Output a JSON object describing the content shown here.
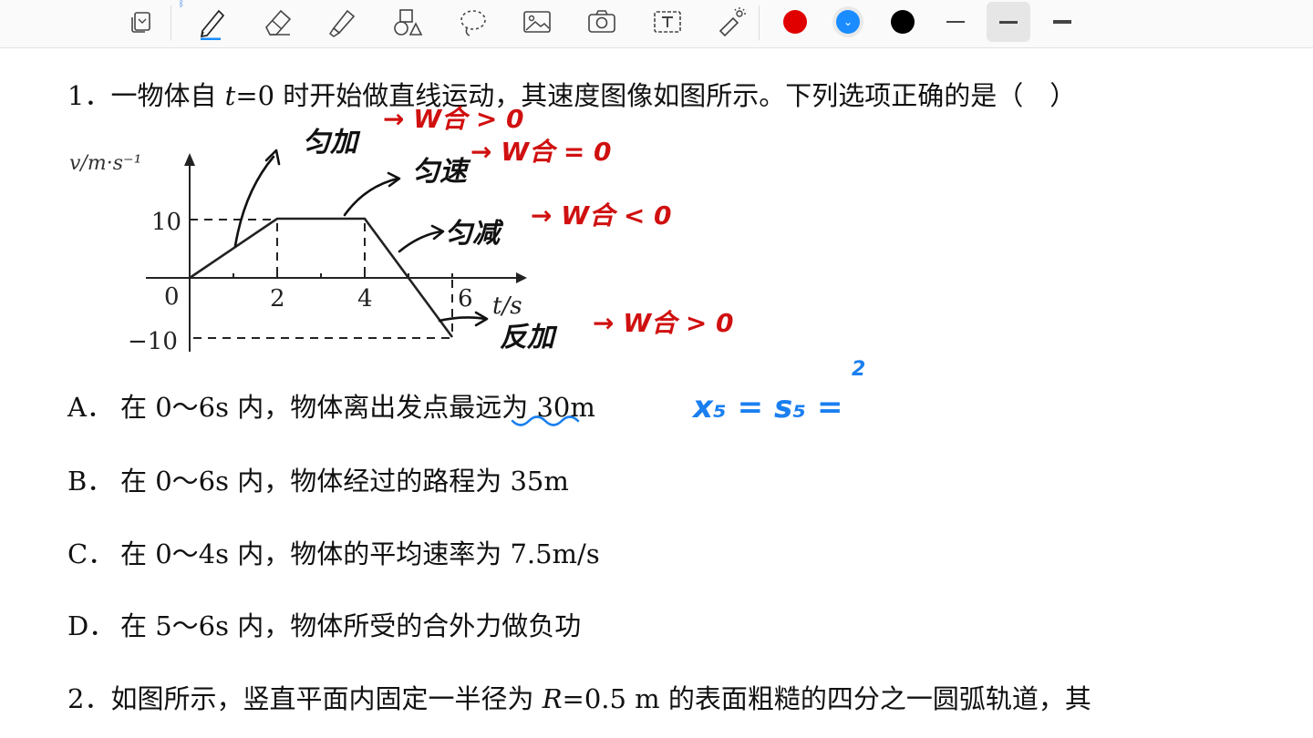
{
  "toolbar": {
    "tools": [
      {
        "name": "page-icon"
      },
      {
        "name": "pen-icon",
        "active": true
      },
      {
        "name": "eraser-icon"
      },
      {
        "name": "highlighter-icon"
      },
      {
        "name": "shapes-icon"
      },
      {
        "name": "lasso-icon"
      },
      {
        "name": "image-icon"
      },
      {
        "name": "camera-icon"
      },
      {
        "name": "text-box-icon"
      },
      {
        "name": "laser-pointer-icon"
      }
    ],
    "colors": [
      "#e00000",
      "#1a8cff",
      "#000000"
    ],
    "selected_color": "#1a8cff",
    "selected_color_mark": "⌄",
    "stroke_widths": [
      "thin",
      "medium",
      "thick"
    ],
    "selected_stroke": "medium"
  },
  "question1": {
    "number": "1．",
    "stem_before": "一物体自 ",
    "stem_var": "t",
    "stem_after": "=0 时开始做直线运动，其速度图像如图所示。下列选项正确的是（　）",
    "graph": {
      "ylabel": "v/m·s⁻¹",
      "xlabel": "t/s",
      "y_ticks": [
        "10",
        "0",
        "−10"
      ],
      "x_ticks": [
        "2",
        "4",
        "6"
      ],
      "chart_data": {
        "type": "line",
        "x": [
          0,
          2,
          4,
          6
        ],
        "y": [
          0,
          10,
          10,
          -10
        ],
        "xlim": [
          0,
          6
        ],
        "ylim": [
          -10,
          10
        ]
      }
    },
    "options": [
      {
        "letter": "A．",
        "text": "在 0～6s 内，物体离出发点最远为 30m"
      },
      {
        "letter": "B．",
        "text": "在 0～6s 内，物体经过的路程为 35m"
      },
      {
        "letter": "C．",
        "text": "在 0～4s 内，物体的平均速率为 7.5m/s"
      },
      {
        "letter": "D．",
        "text": "在 5～6s 内，物体所受的合外力做负功"
      }
    ]
  },
  "question2": {
    "number": "2．",
    "stem_before": "如图所示，竖直平面内固定一半径为 ",
    "stem_var": "R",
    "stem_after": "=0.5 m 的表面粗糙的四分之一圆弧轨道，其"
  },
  "annotations": {
    "black": [
      "匀加",
      "匀速",
      "匀减",
      "反加"
    ],
    "red": [
      "→ W合 > 0",
      "→ W合 = 0",
      "→ W合 < 0",
      "→ W合 > 0"
    ],
    "blue": [
      "x₅ = s₅ =",
      "2"
    ]
  }
}
